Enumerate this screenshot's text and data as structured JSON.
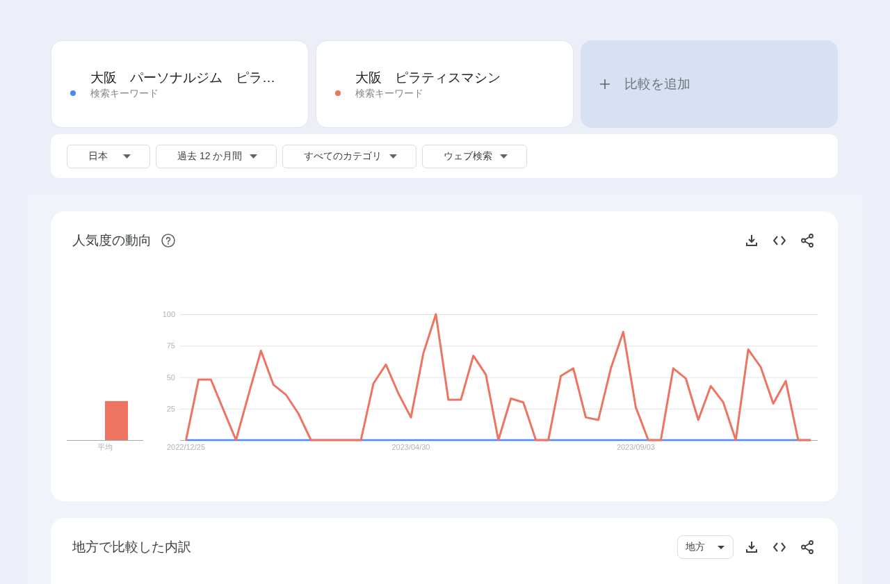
{
  "search_terms": [
    {
      "title": "大阪　パーソナルジム　ピラ…",
      "subtitle": "検索キーワード",
      "color": "#4a88f5"
    },
    {
      "title": "大阪　ピラティスマシン",
      "subtitle": "検索キーワード",
      "color": "#ee7462"
    }
  ],
  "add_comparison": {
    "label": "比較を追加"
  },
  "filters": [
    {
      "label": "日本"
    },
    {
      "label": "過去 12 か月間"
    },
    {
      "label": "すべてのカテゴリ"
    },
    {
      "label": "ウェブ検索"
    }
  ],
  "interest_over_time": {
    "title": "人気度の動向",
    "average": {
      "chart_data": {
        "type": "bar",
        "categories": [
          "平均"
        ],
        "ylim": [
          0,
          100
        ],
        "series": [
          {
            "values": [
              0
            ]
          },
          {
            "color": "#ee7462",
            "values": [
              31
            ]
          }
        ]
      }
    },
    "trend": {
      "chart_data": {
        "type": "line",
        "categories": [
          "2022/12/25",
          null,
          null,
          null,
          null,
          null,
          null,
          null,
          null,
          null,
          null,
          null,
          null,
          null,
          null,
          null,
          null,
          null,
          "2023/04/30",
          null,
          null,
          null,
          null,
          null,
          null,
          null,
          null,
          null,
          null,
          null,
          null,
          null,
          null,
          null,
          null,
          null,
          "2023/09/03",
          null,
          null,
          null,
          null,
          null,
          null,
          null,
          null,
          null,
          null,
          null,
          null,
          null,
          null
        ],
        "ylim": [
          0,
          100
        ],
        "yticks": [
          25,
          50,
          75,
          100
        ],
        "grid": true,
        "series": [
          {
            "color": "#4a88f5",
            "values": [
              0,
              0,
              0,
              0,
              0,
              0,
              0,
              0,
              0,
              0,
              0,
              0,
              0,
              0,
              0,
              0,
              0,
              0,
              0,
              0,
              0,
              0,
              0,
              0,
              0,
              0,
              0,
              0,
              0,
              0,
              0,
              0,
              0,
              0,
              0,
              0,
              0,
              0,
              0,
              0,
              0,
              0,
              0,
              0,
              0,
              0,
              0,
              0,
              0,
              0,
              0
            ]
          },
          {
            "color": "#ee7462",
            "values": [
              0,
              48,
              48,
              24,
              0,
              36,
              71,
              44,
              36,
              21,
              0,
              0,
              0,
              0,
              0,
              45,
              60,
              37,
              18,
              69,
              100,
              32,
              32,
              67,
              52,
              0,
              33,
              30,
              0,
              0,
              51,
              57,
              18,
              16,
              57,
              86,
              26,
              0,
              0,
              57,
              49,
              16,
              43,
              30,
              0,
              72,
              58,
              29,
              47,
              0,
              0
            ]
          }
        ]
      }
    }
  },
  "regional_breakdown": {
    "title": "地方で比較した内訳",
    "dropdown": {
      "label": "地方"
    }
  }
}
